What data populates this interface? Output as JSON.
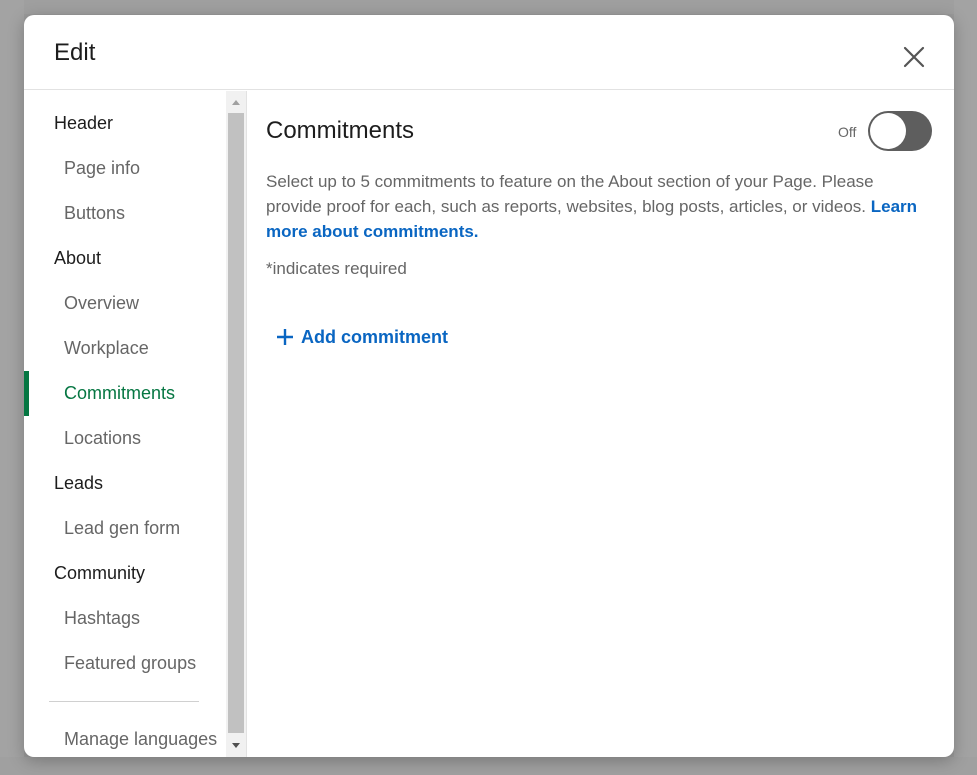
{
  "modal": {
    "title": "Edit"
  },
  "sidebar": {
    "groups": [
      {
        "label": "Header",
        "items": [
          "Page info",
          "Buttons"
        ]
      },
      {
        "label": "About",
        "items": [
          "Overview",
          "Workplace",
          "Commitments",
          "Locations"
        ]
      },
      {
        "label": "Leads",
        "items": [
          "Lead gen form"
        ]
      },
      {
        "label": "Community",
        "items": [
          "Hashtags",
          "Featured groups"
        ]
      }
    ],
    "active_item": "Commitments",
    "footer_item": "Manage languages"
  },
  "content": {
    "title": "Commitments",
    "toggle_label": "Off",
    "toggle_state": "off",
    "description": "Select up to 5 commitments to feature on the About section of your Page. Please provide proof for each, such as reports, websites, blog posts, articles, or videos.",
    "learn_more": "Learn more about commitments.",
    "required_note": "*indicates required",
    "add_button": "Add commitment"
  },
  "colors": {
    "accent_green": "#057642",
    "link_blue": "#0a66c2",
    "toggle_off": "#5e5e5e"
  }
}
